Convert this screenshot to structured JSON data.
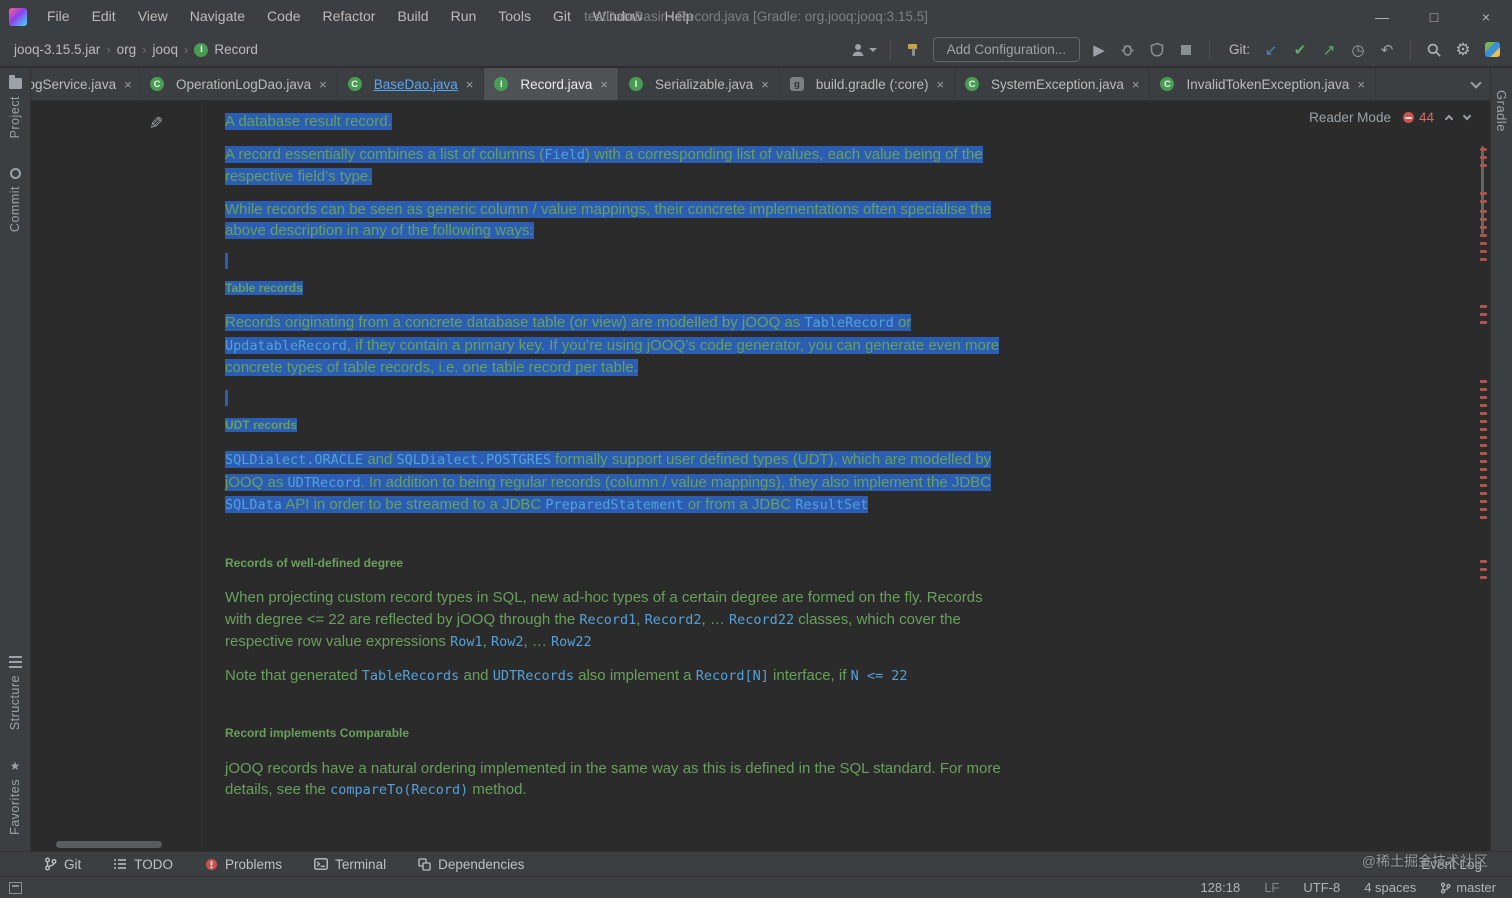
{
  "colors": {
    "selection": "#2b5db2",
    "doc": "#68a05c",
    "code": "#54a1d9",
    "error": "#c75450",
    "green": "#499c54",
    "stripe_mark": "#b3524c"
  },
  "icons": {
    "minimize": "—",
    "maximize": "□",
    "close": "×",
    "tab_close": "×",
    "crumb_sep": "›",
    "git_update": "↙",
    "git_commit": "✔",
    "git_push": "↗",
    "git_history": "◷",
    "git_rollback": "↶",
    "settings": "⚙",
    "pencil": "✎",
    "interface_letter": "I",
    "class_letter": "C",
    "gradle_letter": "g",
    "app_logo": "intellij-gradient-square",
    "user": "person-silhouette",
    "build": "hammer",
    "run": "play-triangle",
    "debug": "bug",
    "coverage": "shield",
    "stop": "square",
    "search": "magnifier",
    "plugins": "colored-square",
    "branch": "git-branch",
    "todo": "checklist",
    "problems": "error-circle",
    "terminal": "console",
    "dependencies": "stack",
    "favorites_star": "★"
  },
  "titlebar": {
    "menus": [
      "File",
      "Edit",
      "View",
      "Navigate",
      "Code",
      "Refactor",
      "Build",
      "Run",
      "Tools",
      "Git",
      "Window",
      "Help"
    ],
    "title": "testDataBasir - Record.java [Gradle: org.jooq:jooq:3.15.5]"
  },
  "toolbar": {
    "breadcrumbs": [
      "jooq-3.15.5.jar",
      "org",
      "jooq",
      "Record"
    ],
    "add_configuration": "Add Configuration...",
    "git_label": "Git:"
  },
  "tabs": [
    {
      "label": "ionLogService.java",
      "cut": true
    },
    {
      "label": "OperationLogDao.java",
      "icon": "class"
    },
    {
      "label": "BaseDao.java",
      "icon": "class",
      "link": true
    },
    {
      "label": "Record.java",
      "icon": "interface",
      "active": true
    },
    {
      "label": "Serializable.java",
      "icon": "interface"
    },
    {
      "label": "build.gradle (:core)",
      "icon": "gradle"
    },
    {
      "label": "SystemException.java",
      "icon": "class"
    },
    {
      "label": "InvalidTokenException.java",
      "icon": "class"
    }
  ],
  "left_stripe": {
    "top": [
      {
        "label": "Project",
        "icon": "project"
      },
      {
        "label": "Commit",
        "icon": "commit"
      }
    ],
    "bottom": [
      {
        "label": "Structure",
        "icon": "structure"
      },
      {
        "label": "Favorites",
        "icon": "favorites"
      }
    ]
  },
  "right_stripe": {
    "label": "Gradle"
  },
  "editor": {
    "reader_mode_label": "Reader Mode",
    "error_count": "44",
    "error_marks": [
      46,
      54,
      62,
      90,
      98,
      108,
      116,
      124,
      132,
      140,
      148,
      156,
      203,
      211,
      219,
      278,
      286,
      294,
      302,
      310,
      318,
      326,
      334,
      342,
      350,
      358,
      366,
      374,
      382,
      390,
      398,
      406,
      414,
      458,
      466,
      474
    ],
    "doc": {
      "blocks": [
        {
          "type": "p",
          "selected": true,
          "segments": [
            {
              "t": "A database result record.",
              "s": "plain"
            }
          ]
        },
        {
          "type": "p",
          "selected": true,
          "segments": [
            {
              "t": "A record essentially combines a list of columns (",
              "s": "plain"
            },
            {
              "t": "Field",
              "s": "code"
            },
            {
              "t": ") with a corresponding list of values, each value being of the respective field’s type.",
              "s": "plain"
            }
          ]
        },
        {
          "type": "p",
          "selected": true,
          "segments": [
            {
              "t": "While records can be seen as generic column / value mappings, their concrete implementations often specialise the above description in any of the following ways:",
              "s": "plain"
            }
          ]
        },
        {
          "type": "gap",
          "selected": true
        },
        {
          "type": "h",
          "selected": true,
          "segments": [
            {
              "t": "Table records",
              "s": "plain"
            }
          ]
        },
        {
          "type": "p",
          "selected": true,
          "segments": [
            {
              "t": "Records originating from a concrete database table (or view) are modelled by jOOQ as ",
              "s": "plain"
            },
            {
              "t": "TableRecord",
              "s": "code"
            },
            {
              "t": " or ",
              "s": "plain"
            },
            {
              "t": "UpdatableRecord",
              "s": "code"
            },
            {
              "t": ", if they contain a primary key. If you’re using jOOQ’s code generator, you can generate even more concrete types of table records, i.e. one table record per table.",
              "s": "plain"
            }
          ]
        },
        {
          "type": "gap",
          "selected": true
        },
        {
          "type": "h",
          "selected": true,
          "segments": [
            {
              "t": "UDT records",
              "s": "plain"
            }
          ]
        },
        {
          "type": "p",
          "selected": true,
          "segments": [
            {
              "t": "SQLDialect.ORACLE",
              "s": "code"
            },
            {
              "t": " and ",
              "s": "plain"
            },
            {
              "t": "SQLDialect.POSTGRES",
              "s": "code"
            },
            {
              "t": " formally support user defined types (UDT), which are modelled by jOOQ as ",
              "s": "plain"
            },
            {
              "t": "UDTRecord",
              "s": "code"
            },
            {
              "t": ". In addition to being regular records (column / value mappings), they also implement the JDBC ",
              "s": "plain"
            },
            {
              "t": "SQLData",
              "s": "code"
            },
            {
              "t": " API in order to be streamed to a JDBC ",
              "s": "plain"
            },
            {
              "t": "PreparedStatement",
              "s": "code"
            },
            {
              "t": " or from a JDBC ",
              "s": "plain"
            },
            {
              "t": "ResultSet",
              "s": "code"
            }
          ]
        },
        {
          "type": "gap",
          "selected": false
        },
        {
          "type": "h",
          "selected": false,
          "segments": [
            {
              "t": "Records of well-defined degree",
              "s": "plain"
            }
          ]
        },
        {
          "type": "p",
          "selected": false,
          "segments": [
            {
              "t": "When projecting custom record types in SQL, new ad-hoc types of a certain degree are formed on the fly. Records with degree <= 22 are reflected by jOOQ through the ",
              "s": "plain"
            },
            {
              "t": "Record1",
              "s": "code"
            },
            {
              "t": ", ",
              "s": "plain"
            },
            {
              "t": "Record2",
              "s": "code"
            },
            {
              "t": ", … ",
              "s": "plain"
            },
            {
              "t": "Record22",
              "s": "code"
            },
            {
              "t": " classes, which cover the respective row value expressions ",
              "s": "plain"
            },
            {
              "t": "Row1",
              "s": "code"
            },
            {
              "t": ", ",
              "s": "plain"
            },
            {
              "t": "Row2",
              "s": "code"
            },
            {
              "t": ", … ",
              "s": "plain"
            },
            {
              "t": "Row22",
              "s": "code"
            }
          ]
        },
        {
          "type": "p",
          "selected": false,
          "segments": [
            {
              "t": "Note that generated ",
              "s": "plain"
            },
            {
              "t": "TableRecords",
              "s": "code"
            },
            {
              "t": " and ",
              "s": "plain"
            },
            {
              "t": "UDTRecords",
              "s": "code"
            },
            {
              "t": " also implement a ",
              "s": "plain"
            },
            {
              "t": "Record[N]",
              "s": "code"
            },
            {
              "t": " interface, if ",
              "s": "plain"
            },
            {
              "t": "N <= 22",
              "s": "code"
            }
          ]
        },
        {
          "type": "gap",
          "selected": false
        },
        {
          "type": "h",
          "selected": false,
          "segments": [
            {
              "t": "Record implements Comparable",
              "s": "plain"
            }
          ]
        },
        {
          "type": "p",
          "selected": false,
          "segments": [
            {
              "t": "jOOQ records have a natural ordering implemented in the same way as this is defined in the SQL standard. For more details, see the ",
              "s": "plain"
            },
            {
              "t": "compareTo(Record)",
              "s": "link"
            },
            {
              "t": " method.",
              "s": "plain"
            }
          ]
        }
      ]
    }
  },
  "bottom_bar": {
    "items": [
      {
        "label": "Git",
        "icon": "branch"
      },
      {
        "label": "TODO",
        "icon": "todo"
      },
      {
        "label": "Problems",
        "icon": "problems"
      },
      {
        "label": "Terminal",
        "icon": "terminal"
      },
      {
        "label": "Dependencies",
        "icon": "dependencies"
      }
    ],
    "event_log": "Event Log",
    "watermark": "@稀土掘金技术社区"
  },
  "status_bar": {
    "items": [
      {
        "label": "128:18"
      },
      {
        "label": "LF",
        "dim": true
      },
      {
        "label": "UTF-8"
      },
      {
        "label": "4 spaces"
      },
      {
        "label": "master",
        "icon": "branch"
      }
    ]
  }
}
